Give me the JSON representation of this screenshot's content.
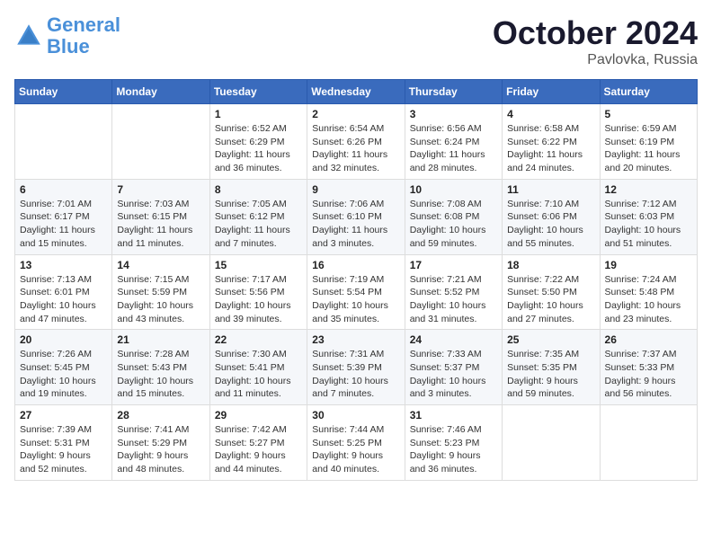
{
  "logo": {
    "line1": "General",
    "line2": "Blue"
  },
  "title": "October 2024",
  "location": "Pavlovka, Russia",
  "days_header": [
    "Sunday",
    "Monday",
    "Tuesday",
    "Wednesday",
    "Thursday",
    "Friday",
    "Saturday"
  ],
  "weeks": [
    [
      {
        "day": "",
        "info": ""
      },
      {
        "day": "",
        "info": ""
      },
      {
        "day": "1",
        "info": "Sunrise: 6:52 AM\nSunset: 6:29 PM\nDaylight: 11 hours\nand 36 minutes."
      },
      {
        "day": "2",
        "info": "Sunrise: 6:54 AM\nSunset: 6:26 PM\nDaylight: 11 hours\nand 32 minutes."
      },
      {
        "day": "3",
        "info": "Sunrise: 6:56 AM\nSunset: 6:24 PM\nDaylight: 11 hours\nand 28 minutes."
      },
      {
        "day": "4",
        "info": "Sunrise: 6:58 AM\nSunset: 6:22 PM\nDaylight: 11 hours\nand 24 minutes."
      },
      {
        "day": "5",
        "info": "Sunrise: 6:59 AM\nSunset: 6:19 PM\nDaylight: 11 hours\nand 20 minutes."
      }
    ],
    [
      {
        "day": "6",
        "info": "Sunrise: 7:01 AM\nSunset: 6:17 PM\nDaylight: 11 hours\nand 15 minutes."
      },
      {
        "day": "7",
        "info": "Sunrise: 7:03 AM\nSunset: 6:15 PM\nDaylight: 11 hours\nand 11 minutes."
      },
      {
        "day": "8",
        "info": "Sunrise: 7:05 AM\nSunset: 6:12 PM\nDaylight: 11 hours\nand 7 minutes."
      },
      {
        "day": "9",
        "info": "Sunrise: 7:06 AM\nSunset: 6:10 PM\nDaylight: 11 hours\nand 3 minutes."
      },
      {
        "day": "10",
        "info": "Sunrise: 7:08 AM\nSunset: 6:08 PM\nDaylight: 10 hours\nand 59 minutes."
      },
      {
        "day": "11",
        "info": "Sunrise: 7:10 AM\nSunset: 6:06 PM\nDaylight: 10 hours\nand 55 minutes."
      },
      {
        "day": "12",
        "info": "Sunrise: 7:12 AM\nSunset: 6:03 PM\nDaylight: 10 hours\nand 51 minutes."
      }
    ],
    [
      {
        "day": "13",
        "info": "Sunrise: 7:13 AM\nSunset: 6:01 PM\nDaylight: 10 hours\nand 47 minutes."
      },
      {
        "day": "14",
        "info": "Sunrise: 7:15 AM\nSunset: 5:59 PM\nDaylight: 10 hours\nand 43 minutes."
      },
      {
        "day": "15",
        "info": "Sunrise: 7:17 AM\nSunset: 5:56 PM\nDaylight: 10 hours\nand 39 minutes."
      },
      {
        "day": "16",
        "info": "Sunrise: 7:19 AM\nSunset: 5:54 PM\nDaylight: 10 hours\nand 35 minutes."
      },
      {
        "day": "17",
        "info": "Sunrise: 7:21 AM\nSunset: 5:52 PM\nDaylight: 10 hours\nand 31 minutes."
      },
      {
        "day": "18",
        "info": "Sunrise: 7:22 AM\nSunset: 5:50 PM\nDaylight: 10 hours\nand 27 minutes."
      },
      {
        "day": "19",
        "info": "Sunrise: 7:24 AM\nSunset: 5:48 PM\nDaylight: 10 hours\nand 23 minutes."
      }
    ],
    [
      {
        "day": "20",
        "info": "Sunrise: 7:26 AM\nSunset: 5:45 PM\nDaylight: 10 hours\nand 19 minutes."
      },
      {
        "day": "21",
        "info": "Sunrise: 7:28 AM\nSunset: 5:43 PM\nDaylight: 10 hours\nand 15 minutes."
      },
      {
        "day": "22",
        "info": "Sunrise: 7:30 AM\nSunset: 5:41 PM\nDaylight: 10 hours\nand 11 minutes."
      },
      {
        "day": "23",
        "info": "Sunrise: 7:31 AM\nSunset: 5:39 PM\nDaylight: 10 hours\nand 7 minutes."
      },
      {
        "day": "24",
        "info": "Sunrise: 7:33 AM\nSunset: 5:37 PM\nDaylight: 10 hours\nand 3 minutes."
      },
      {
        "day": "25",
        "info": "Sunrise: 7:35 AM\nSunset: 5:35 PM\nDaylight: 9 hours\nand 59 minutes."
      },
      {
        "day": "26",
        "info": "Sunrise: 7:37 AM\nSunset: 5:33 PM\nDaylight: 9 hours\nand 56 minutes."
      }
    ],
    [
      {
        "day": "27",
        "info": "Sunrise: 7:39 AM\nSunset: 5:31 PM\nDaylight: 9 hours\nand 52 minutes."
      },
      {
        "day": "28",
        "info": "Sunrise: 7:41 AM\nSunset: 5:29 PM\nDaylight: 9 hours\nand 48 minutes."
      },
      {
        "day": "29",
        "info": "Sunrise: 7:42 AM\nSunset: 5:27 PM\nDaylight: 9 hours\nand 44 minutes."
      },
      {
        "day": "30",
        "info": "Sunrise: 7:44 AM\nSunset: 5:25 PM\nDaylight: 9 hours\nand 40 minutes."
      },
      {
        "day": "31",
        "info": "Sunrise: 7:46 AM\nSunset: 5:23 PM\nDaylight: 9 hours\nand 36 minutes."
      },
      {
        "day": "",
        "info": ""
      },
      {
        "day": "",
        "info": ""
      }
    ]
  ]
}
